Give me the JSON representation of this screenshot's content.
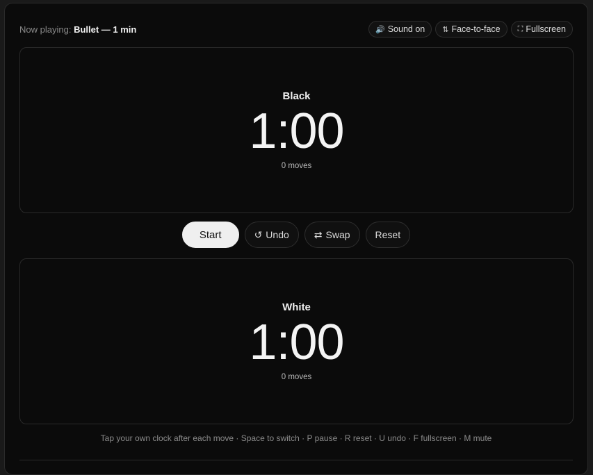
{
  "header": {
    "now_playing_label": "Now playing:",
    "now_playing_value": "Bullet — 1 min"
  },
  "toolbar": {
    "sound": {
      "icon": "speaker-icon",
      "glyph": "🔊",
      "label": "Sound on"
    },
    "face": {
      "icon": "flip-vertical-icon",
      "glyph": "⇅",
      "label": "Face-to-face"
    },
    "fullscreen": {
      "icon": "fullscreen-icon",
      "glyph": "⛶",
      "label": "Fullscreen"
    }
  },
  "black_clock": {
    "player": "Black",
    "time": "1:00",
    "moves": "0 moves"
  },
  "controls": {
    "start_label": "Start",
    "undo": {
      "icon": "undo-icon",
      "glyph": "↺",
      "label": "Undo"
    },
    "swap": {
      "icon": "swap-icon",
      "glyph": "⇄",
      "label": "Swap"
    },
    "reset_label": "Reset"
  },
  "white_clock": {
    "player": "White",
    "time": "1:00",
    "moves": "0 moves"
  },
  "footer": {
    "hint": "Tap your own clock after each move · Space to switch · P pause · R reset · U undo · F fullscreen · M mute"
  }
}
